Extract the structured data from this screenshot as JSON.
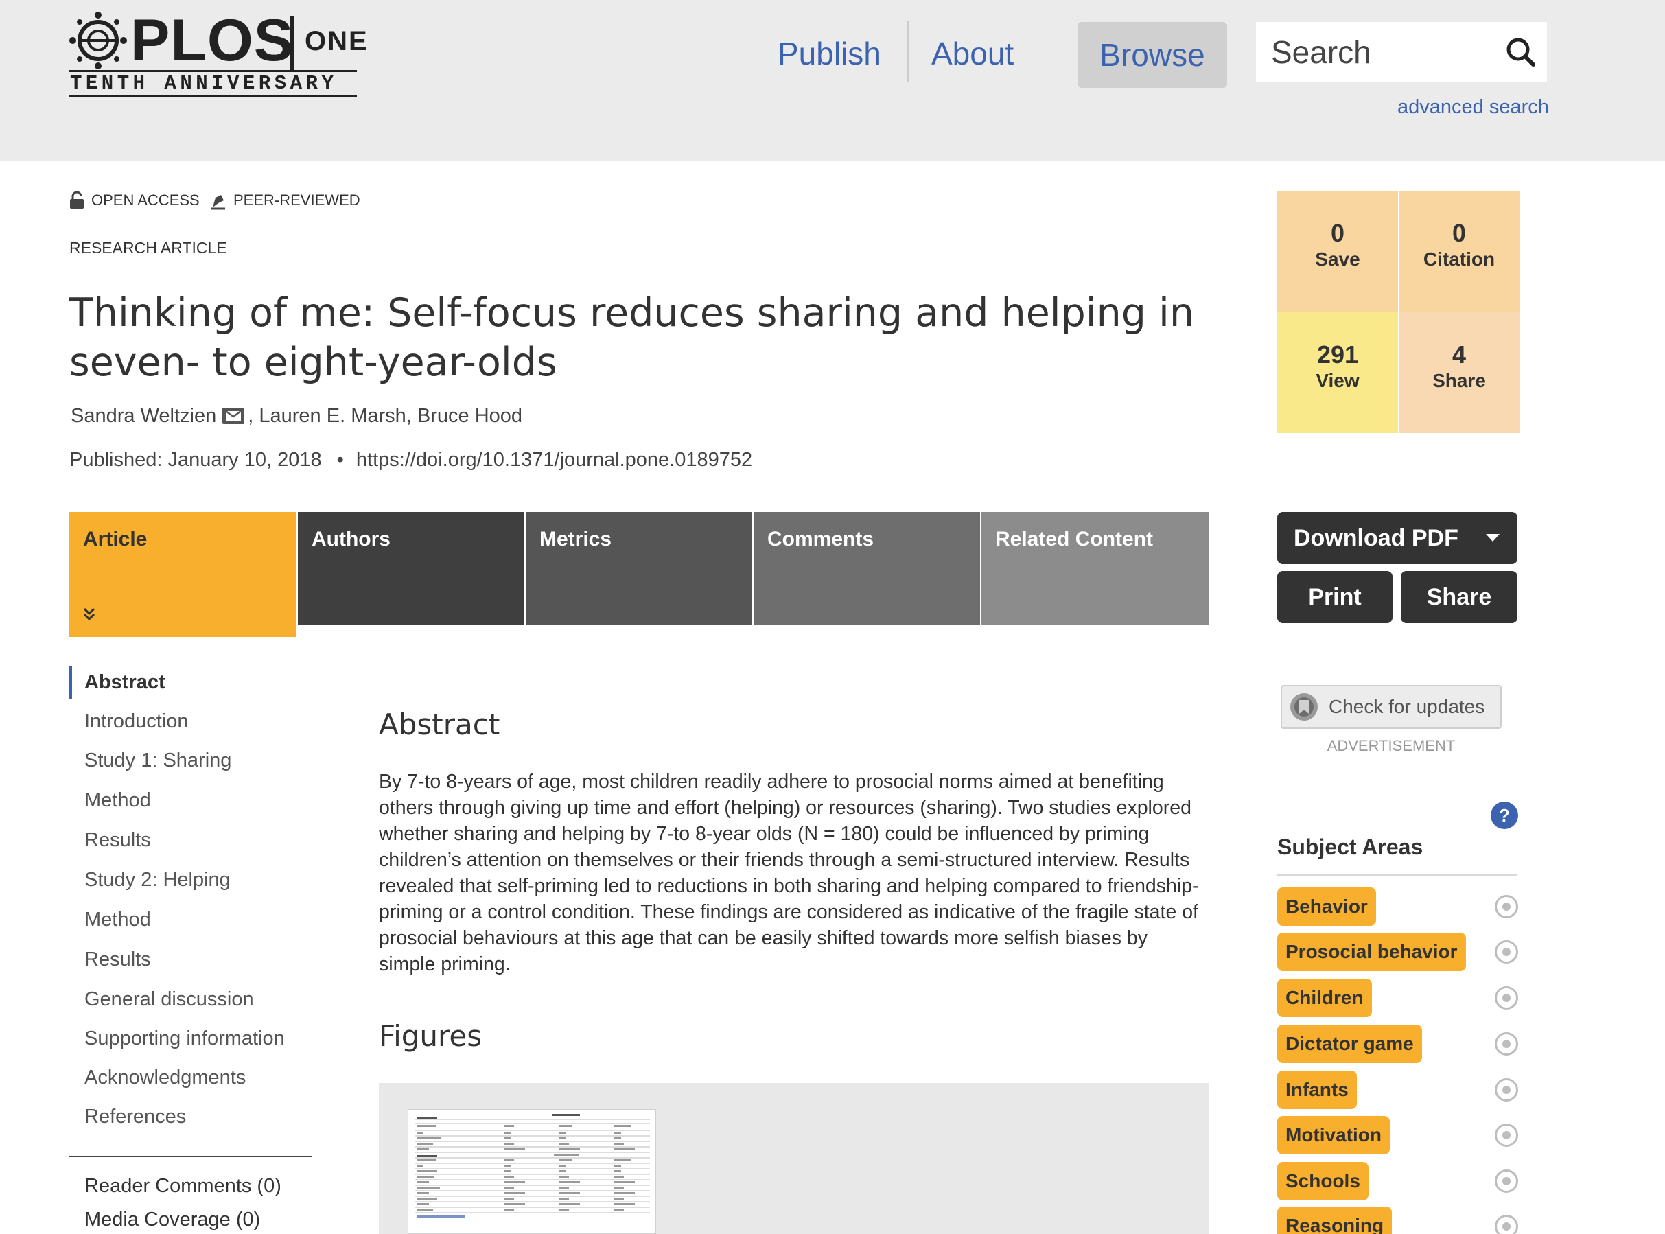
{
  "header": {
    "logo": {
      "wordmark": "PLOS",
      "suffix": "ONE",
      "tagline": "TENTH ANNIVERSARY"
    },
    "nav": {
      "publish": "Publish",
      "about": "About",
      "browse": "Browse"
    },
    "search": {
      "placeholder": "Search",
      "advanced": "advanced search"
    }
  },
  "article": {
    "badges": {
      "open_access": "OPEN ACCESS",
      "peer_reviewed": "PEER-REVIEWED"
    },
    "type": "RESEARCH ARTICLE",
    "title": "Thinking of me: Self-focus reduces sharing and helping in seven- to eight-year-olds",
    "authors": [
      "Sandra Weltzien",
      "Lauren E. Marsh",
      "Bruce Hood"
    ],
    "published": "Published: January 10, 2018",
    "separator": "•",
    "doi": "https://doi.org/10.1371/journal.pone.0189752"
  },
  "metrics": [
    {
      "value": "0",
      "label": "Save",
      "color": "#f9d5a0"
    },
    {
      "value": "0",
      "label": "Citation",
      "color": "#f9d5a0"
    },
    {
      "value": "291",
      "label": "View",
      "color": "#f9e98b"
    },
    {
      "value": "4",
      "label": "Share",
      "color": "#f9d9b1"
    }
  ],
  "tabs": [
    {
      "label": "Article",
      "color": "#f8af2d"
    },
    {
      "label": "Authors",
      "color": "#3f3f3f"
    },
    {
      "label": "Metrics",
      "color": "#555555"
    },
    {
      "label": "Comments",
      "color": "#6e6e6e"
    },
    {
      "label": "Related Content",
      "color": "#8c8c8c"
    }
  ],
  "actions": {
    "download_pdf": "Download PDF",
    "print": "Print",
    "share": "Share",
    "check_updates": "Check for updates",
    "advertisement": "ADVERTISEMENT"
  },
  "toc": {
    "items": [
      "Abstract",
      "Introduction",
      "Study 1: Sharing",
      "Method",
      "Results",
      "Study 2: Helping",
      "Method",
      "Results",
      "General discussion",
      "Supporting information",
      "Acknowledgments",
      "References"
    ],
    "reader_comments": "Reader Comments (0)",
    "media_coverage": "Media Coverage (0)"
  },
  "content": {
    "abstract_heading": "Abstract",
    "abstract_text": "By 7-to 8-years of age, most children readily adhere to prosocial norms aimed at benefiting others through giving up time and effort (helping) or resources (sharing). Two studies explored whether sharing and helping by 7-to 8-year olds (N = 180) could be influenced by priming children’s attention on themselves or their friends through a semi-structured interview. Results revealed that self-priming led to reductions in both sharing and helping compared to friendship-priming or a control condition. These findings are considered as indicative of the fragile state of prosocial behaviours at this age that can be easily shifted towards more selfish biases by simple priming.",
    "figures_heading": "Figures"
  },
  "subject_areas": {
    "title": "Subject Areas",
    "help": "?",
    "items": [
      "Behavior",
      "Prosocial behavior",
      "Children",
      "Dictator game",
      "Infants",
      "Motivation",
      "Schools",
      "Reasoning"
    ]
  },
  "colors": {
    "link_blue": "#3c63af",
    "header_bg": "#ebebeb",
    "accent_orange": "#f8af2d",
    "dark_button": "#333333"
  }
}
